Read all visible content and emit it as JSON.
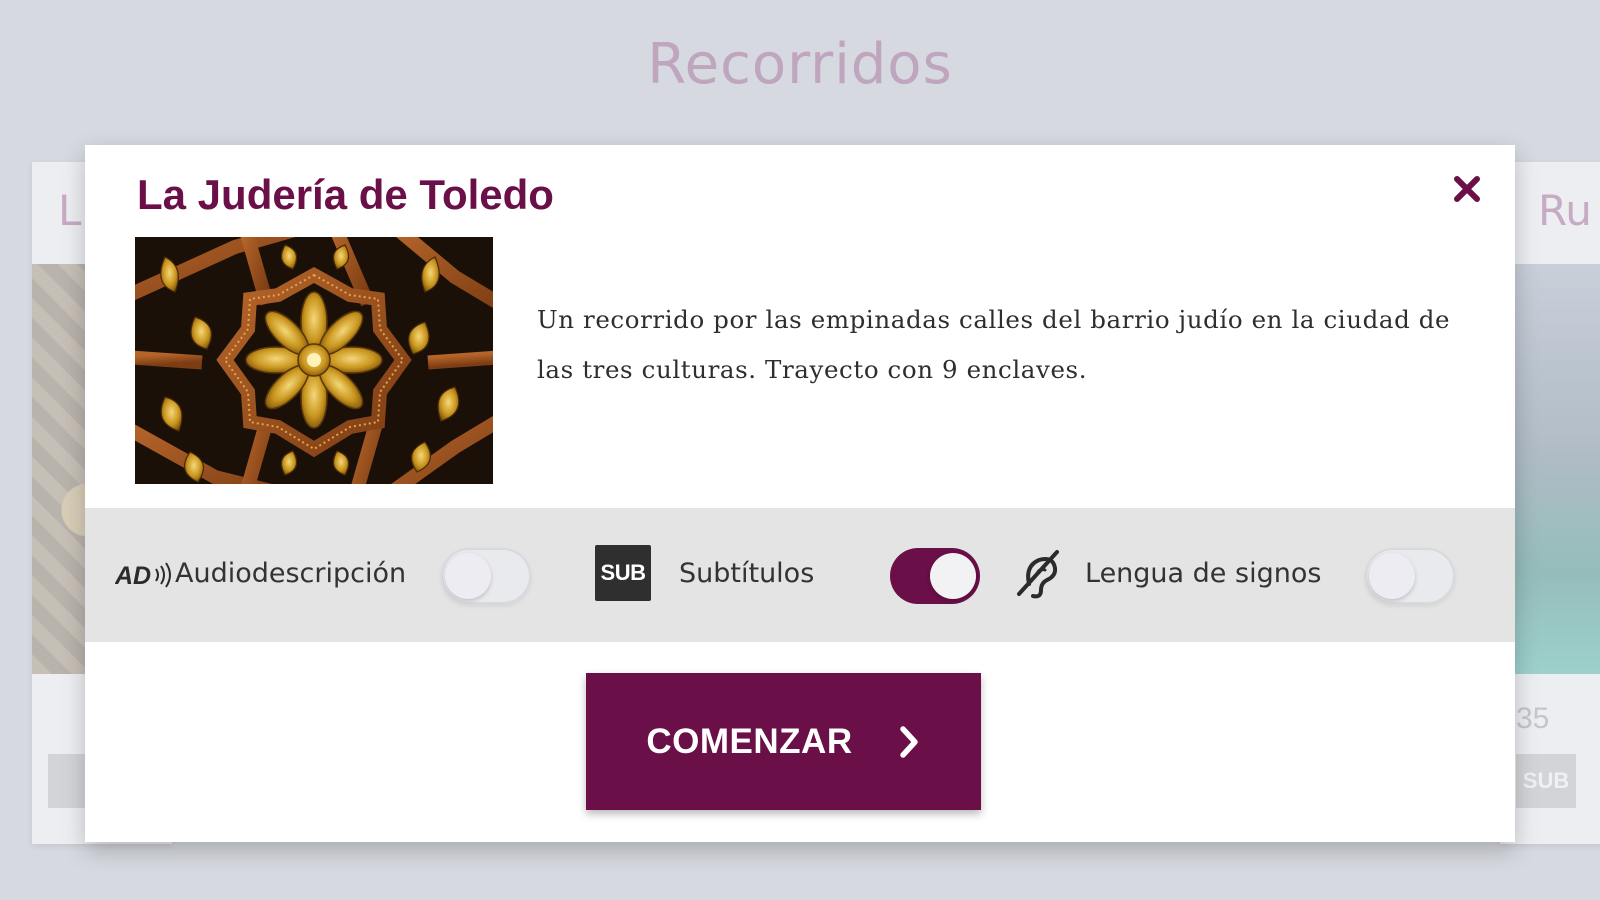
{
  "page": {
    "title": "Recorridos"
  },
  "background_cards": {
    "left": {
      "title_fragment": "L",
      "meta_fragment": "",
      "badge": ""
    },
    "right": {
      "title_fragment": "Ru",
      "meta_fragment": "35 ",
      "badge": "SUB"
    }
  },
  "modal": {
    "title": "La Judería de Toledo",
    "close_icon": "close-icon",
    "image_icon": "mudejar-ceiling-pattern",
    "description": "Un recorrido por las empinadas calles del barrio judío en la ciudad de las tres culturas. Trayecto con 9 enclaves.",
    "options": {
      "audio": {
        "icon_text": "AD",
        "label": "Audiodescripción",
        "enabled": false
      },
      "subtitles": {
        "icon_text": "SUB",
        "label": "Subtítulos",
        "enabled": true
      },
      "sign": {
        "icon": "ear-sign-language-icon",
        "label": "Lengua de signos",
        "enabled": false
      }
    },
    "start_button": {
      "label": "COMENZAR",
      "icon": "chevron-right-icon"
    }
  },
  "colors": {
    "accent": "#6a0f47",
    "backdrop": "#d6d9e0",
    "options_bar": "#e4e4e4"
  }
}
